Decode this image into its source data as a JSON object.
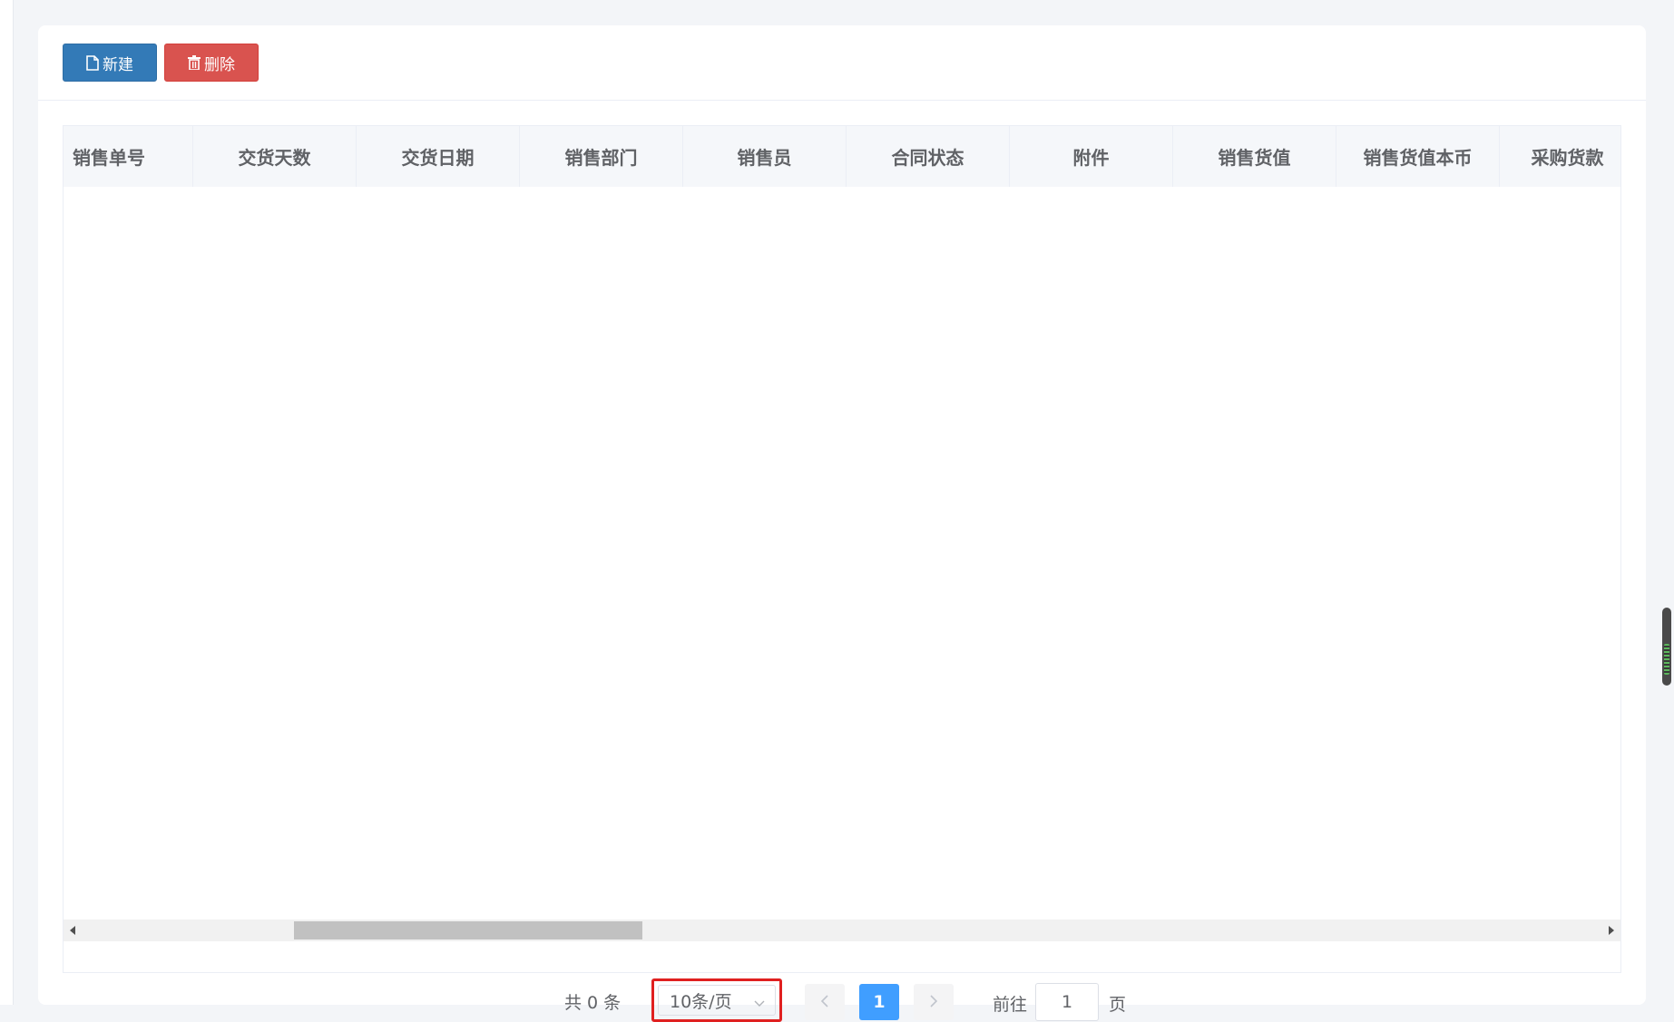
{
  "toolbar": {
    "new_label": "新建",
    "delete_label": "删除",
    "new_icon": "file-icon",
    "delete_icon": "trash-icon"
  },
  "table": {
    "columns": [
      "销售单号",
      "交货天数",
      "交货日期",
      "销售部门",
      "销售员",
      "合同状态",
      "附件",
      "销售货值",
      "销售货值本币",
      "采购货款"
    ],
    "rows": []
  },
  "pagination": {
    "total_text": "共 0 条",
    "page_size": "10条/页",
    "current_page": "1",
    "goto_prefix": "前往",
    "goto_value": "1",
    "goto_suffix": "页"
  },
  "colors": {
    "primary_button": "#337ab7",
    "danger_button": "#d9534f",
    "active_page": "#409eff",
    "highlight_box": "#e02020"
  }
}
